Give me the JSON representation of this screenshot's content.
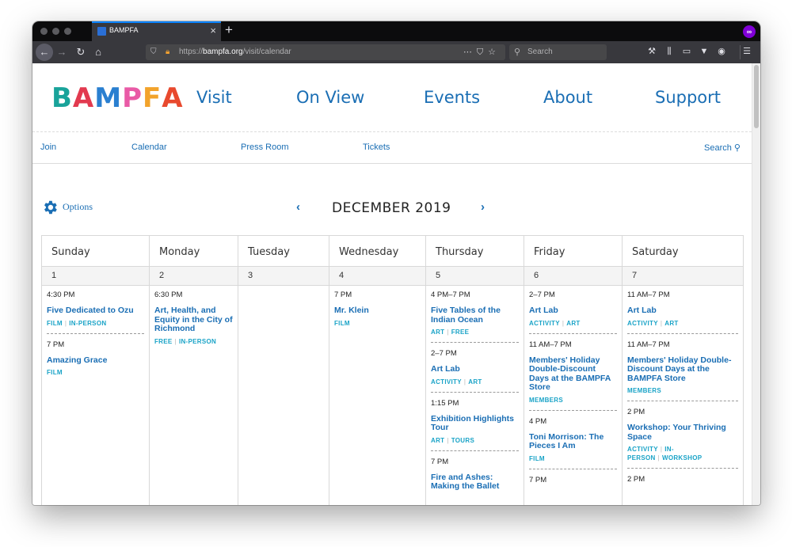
{
  "browser": {
    "tab_title": "BAMPFA",
    "new_tab": "+",
    "tab_close": "×",
    "url_prefix": "https://",
    "url_domain": "bampfa.org",
    "url_path": "/visit/calendar",
    "search_placeholder": "Search"
  },
  "site": {
    "logo_letters": [
      {
        "ch": "B",
        "color": "#19a39a"
      },
      {
        "ch": "A",
        "color": "#e23a4f"
      },
      {
        "ch": "M",
        "color": "#2a7fd0"
      },
      {
        "ch": "P",
        "color": "#e95aa6"
      },
      {
        "ch": "F",
        "color": "#f2a32b"
      },
      {
        "ch": "A",
        "color": "#e8492e"
      }
    ],
    "main_nav": [
      "Visit",
      "On View",
      "Events",
      "About",
      "Support"
    ],
    "sub_nav": [
      "Join",
      "Calendar",
      "Press Room",
      "Tickets"
    ],
    "search_label": "Search",
    "accent_color": "#1a6eb4",
    "tag_color": "#19a3c7"
  },
  "calendar": {
    "options_label": "Options",
    "month_title": "DECEMBER 2019",
    "prev": "‹",
    "next": "›",
    "days": [
      {
        "name": "Sunday",
        "date": "1",
        "events": [
          {
            "time": "4:30 PM",
            "title": "Five Dedicated to Ozu",
            "tags": [
              "FILM",
              "IN-PERSON"
            ]
          },
          {
            "time": "7 PM",
            "title": "Amazing Grace",
            "tags": [
              "FILM"
            ]
          }
        ]
      },
      {
        "name": "Monday",
        "date": "2",
        "events": [
          {
            "time": "6:30 PM",
            "title": "Art, Health, and Equity in the City of Richmond",
            "tags": [
              "FREE",
              "IN-PERSON"
            ]
          }
        ]
      },
      {
        "name": "Tuesday",
        "date": "3",
        "events": []
      },
      {
        "name": "Wednesday",
        "date": "4",
        "events": [
          {
            "time": "7 PM",
            "title": "Mr. Klein",
            "tags": [
              "FILM"
            ]
          }
        ]
      },
      {
        "name": "Thursday",
        "date": "5",
        "events": [
          {
            "time": "4 PM–7 PM",
            "title": "Five Tables of the Indian Ocean",
            "tags": [
              "ART",
              "FREE"
            ]
          },
          {
            "time": "2–7 PM",
            "title": "Art Lab",
            "tags": [
              "ACTIVITY",
              "ART"
            ]
          },
          {
            "time": "1:15 PM",
            "title": "Exhibition Highlights Tour",
            "tags": [
              "ART",
              "TOURS"
            ]
          },
          {
            "time": "7 PM",
            "title": "Fire and Ashes: Making the Ballet",
            "tags": []
          }
        ]
      },
      {
        "name": "Friday",
        "date": "6",
        "events": [
          {
            "time": "2–7 PM",
            "title": "Art Lab",
            "tags": [
              "ACTIVITY",
              "ART"
            ]
          },
          {
            "time": "11 AM–7 PM",
            "title": "Members' Holiday Double-Discount Days at the BAMPFA Store",
            "tags": [
              "MEMBERS"
            ]
          },
          {
            "time": "4 PM",
            "title": "Toni Morrison: The Pieces I Am",
            "tags": [
              "FILM"
            ]
          },
          {
            "time": "7 PM",
            "title": "",
            "tags": []
          }
        ]
      },
      {
        "name": "Saturday",
        "date": "7",
        "events": [
          {
            "time": "11 AM–7 PM",
            "title": "Art Lab",
            "tags": [
              "ACTIVITY",
              "ART"
            ]
          },
          {
            "time": "11 AM–7 PM",
            "title": "Members' Holiday Double-Discount Days at the BAMPFA Store",
            "tags": [
              "MEMBERS"
            ]
          },
          {
            "time": "2 PM",
            "title": "Workshop: Your Thriving Space",
            "tags": [
              "ACTIVITY",
              "IN-PERSON",
              "WORKSHOP"
            ]
          },
          {
            "time": "2 PM",
            "title": "",
            "tags": []
          }
        ]
      }
    ]
  }
}
